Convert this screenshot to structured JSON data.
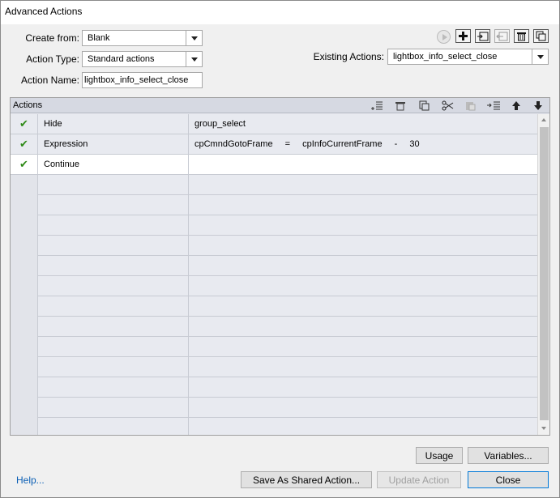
{
  "window": {
    "title": "Advanced Actions"
  },
  "form": {
    "create_from_label": "Create from:",
    "create_from_value": "Blank",
    "action_type_label": "Action Type:",
    "action_type_value": "Standard actions",
    "action_name_label": "Action Name:",
    "action_name_value": "lightbox_info_select_close",
    "existing_actions_label": "Existing Actions:",
    "existing_actions_value": "lightbox_info_select_close"
  },
  "top_toolbar": {
    "icons": [
      "preview-play-icon",
      "add-icon",
      "import-icon",
      "export-icon",
      "delete-icon",
      "duplicate-icon"
    ]
  },
  "grid": {
    "header_label": "Actions",
    "header_icons": [
      "insert-row-icon",
      "delete-row-icon",
      "copy-icon",
      "cut-icon",
      "paste-icon",
      "indent-icon",
      "move-up-icon",
      "move-down-icon"
    ],
    "rows": [
      {
        "checked": true,
        "action": "Hide",
        "target": "group_select"
      },
      {
        "checked": true,
        "action": "Expression",
        "target_parts": [
          "cpCmndGotoFrame",
          "=",
          "cpInfoCurrentFrame",
          "-",
          "30"
        ]
      },
      {
        "checked": true,
        "action": "Continue",
        "target": ""
      }
    ],
    "empty_rows": 13
  },
  "buttons": {
    "usage": "Usage",
    "variables": "Variables...",
    "save_shared": "Save As Shared Action...",
    "update": "Update Action",
    "close": "Close"
  },
  "help_link": "Help...",
  "colors": {
    "check": "#2f8a18",
    "link": "#0b5fb5",
    "header_bg": "#d6d9e2",
    "row_bg": "#e8eaf0"
  }
}
